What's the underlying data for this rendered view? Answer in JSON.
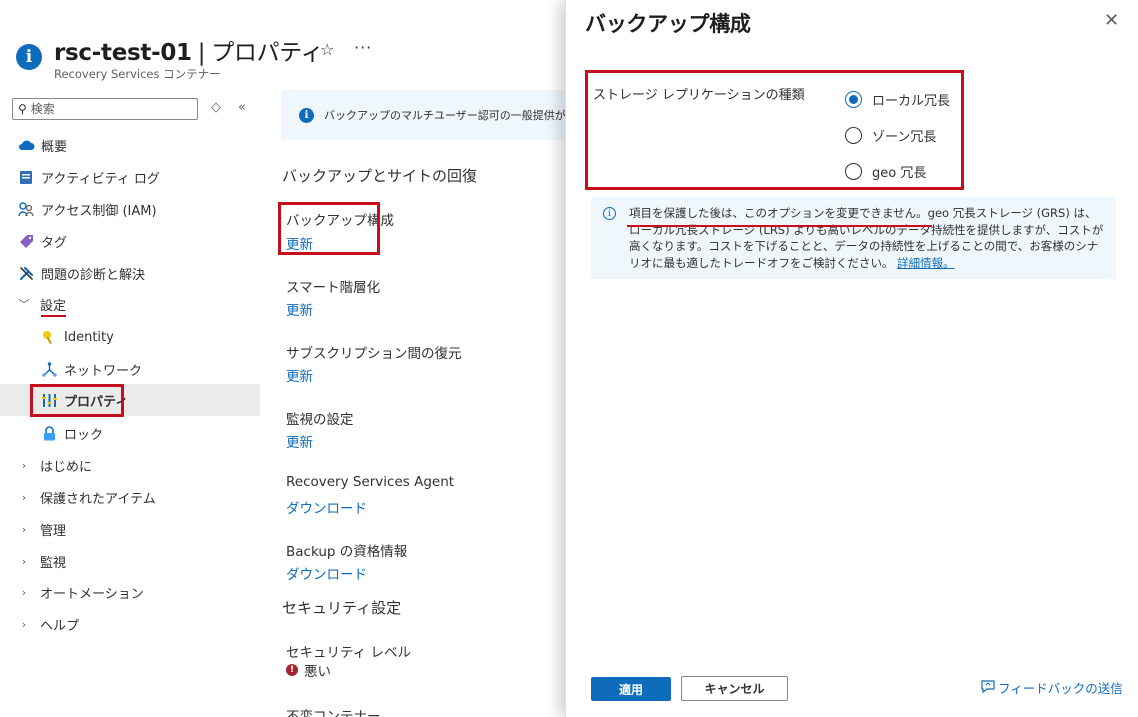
{
  "header": {
    "title": "rsc-test-01",
    "separator": "|",
    "page": "プロパティ",
    "subtitle": "Recovery Services コンテナー"
  },
  "sidebar": {
    "search_placeholder": "検索",
    "items": [
      {
        "label": "概要",
        "icon": "cloud-icon"
      },
      {
        "label": "アクティビティ ログ",
        "icon": "activity-log-icon"
      },
      {
        "label": "アクセス制御 (IAM)",
        "icon": "people-icon"
      },
      {
        "label": "タグ",
        "icon": "tag-icon"
      },
      {
        "label": "問題の診断と解決",
        "icon": "wrench-icon"
      },
      {
        "label": "設定",
        "icon": "chevron-down-icon"
      },
      {
        "label": "Identity",
        "icon": "key-icon"
      },
      {
        "label": "ネットワーク",
        "icon": "network-icon"
      },
      {
        "label": "プロパティ",
        "icon": "properties-icon"
      },
      {
        "label": "ロック",
        "icon": "lock-icon"
      },
      {
        "label": "はじめに",
        "icon": "chevron-right-icon"
      },
      {
        "label": "保護されたアイテム",
        "icon": "chevron-right-icon"
      },
      {
        "label": "管理",
        "icon": "chevron-right-icon"
      },
      {
        "label": "監視",
        "icon": "chevron-right-icon"
      },
      {
        "label": "オートメーション",
        "icon": "chevron-right-icon"
      },
      {
        "label": "ヘルプ",
        "icon": "chevron-right-icon"
      }
    ]
  },
  "main": {
    "banner": "バックアップのマルチユーザー認可の一般提供が開始",
    "section_backup": "バックアップとサイトの回復",
    "items": [
      {
        "title": "バックアップ構成",
        "link": "更新"
      },
      {
        "title": "スマート階層化",
        "link": "更新"
      },
      {
        "title": "サブスクリプション間の復元",
        "link": "更新"
      },
      {
        "title": "監視の設定",
        "link": "更新"
      },
      {
        "title": "Recovery Services Agent",
        "link": "ダウンロード"
      },
      {
        "title": "Backup の資格情報",
        "link": "ダウンロード"
      }
    ],
    "section_security": "セキュリティ設定",
    "security_level_title": "セキュリティ レベル",
    "security_level_value": "悪い",
    "immutable_title": "不変コンテナー"
  },
  "panel": {
    "title": "バックアップ構成",
    "storage_label": "ストレージ レプリケーションの種類",
    "options": [
      "ローカル冗長",
      "ゾーン冗長",
      "geo 冗長"
    ],
    "selected": "ローカル冗長",
    "info_highlight": "項目を保護した後は、このオプションを変更できません。",
    "info_rest": "geo 冗長ストレージ (GRS) は、ローカル冗長ストレージ (LRS) よりも高いレベルのデータ持続性を提供しますが、コストが高くなります。コストを下げることと、データの持続性を上げることの間で、お客様のシナリオに最も適したトレードオフをご検討ください。",
    "info_link": "詳細情報。",
    "apply": "適用",
    "cancel": "キャンセル",
    "feedback": "フィードバックの送信"
  },
  "colors": {
    "accent": "#0f6cbd",
    "highlight_red": "#c50f1f",
    "banner_bg": "#eff6fc"
  }
}
